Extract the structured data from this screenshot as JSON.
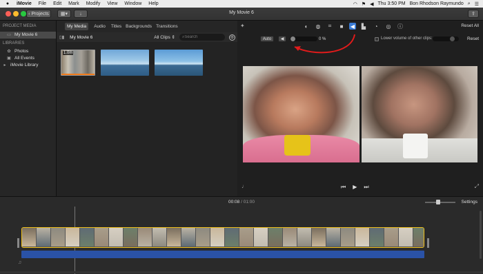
{
  "menubar": {
    "app_name": "iMovie",
    "items": [
      "File",
      "Edit",
      "Mark",
      "Modify",
      "View",
      "Window",
      "Help"
    ],
    "clock": "Thu 3:50 PM",
    "user": "Bon Rhodson Raymundo"
  },
  "toolbar": {
    "projects_label": "Projects",
    "title": "My Movie 6"
  },
  "sidebar": {
    "project_media_header": "PROJECT MEDIA",
    "project_item": "My Movie 6",
    "libraries_header": "LIBRARIES",
    "library_items": [
      "Photos",
      "All Events",
      "iMovie Library"
    ]
  },
  "browser": {
    "tabs": [
      "My Media",
      "Audio",
      "Titles",
      "Backgrounds",
      "Transitions"
    ],
    "title": "My Movie 6",
    "filter": "All Clips",
    "search_placeholder": "Search",
    "clip1_duration": "1.0m"
  },
  "viewer": {
    "reset_all": "Reset All",
    "auto_label": "Auto",
    "volume_pct": "0 %",
    "lower_volume_label": "Lower volume of other clips:",
    "reset": "Reset"
  },
  "timeline": {
    "current": "00:08",
    "total": "01:00",
    "separator": " / ",
    "settings": "Settings"
  },
  "colors": {
    "accent": "#3a7bd5",
    "selection_yellow": "#f2c21b",
    "audio_blue": "#2a52a6",
    "arrow_red": "#e21b1b"
  }
}
